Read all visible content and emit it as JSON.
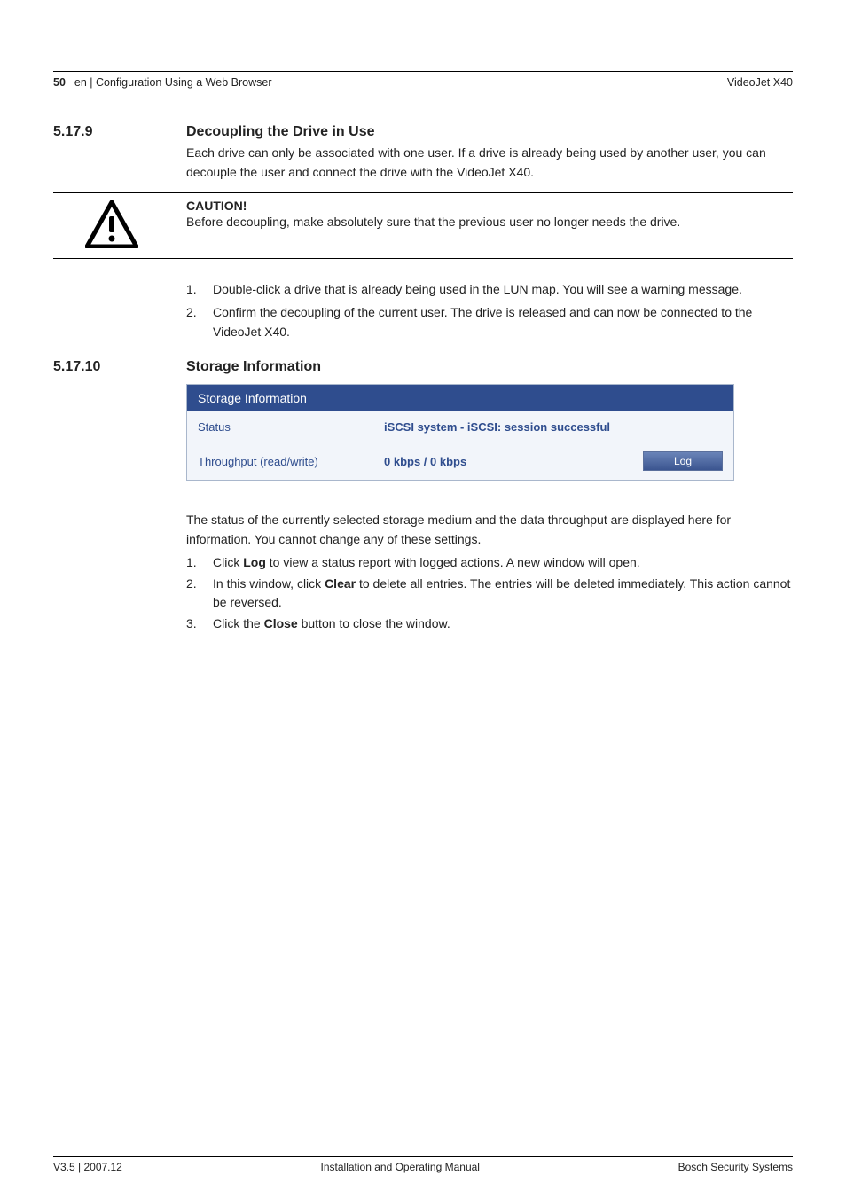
{
  "header": {
    "page_number": "50",
    "breadcrumb": "en | Configuration Using a Web Browser",
    "product": "VideoJet X40"
  },
  "section1": {
    "number": "5.17.9",
    "title": "Decoupling the Drive in Use",
    "intro": "Each drive can only be associated with one user. If a drive is already being used by another user, you can decouple the user and connect the drive with the VideoJet X40.",
    "caution_heading": "CAUTION!",
    "caution_text": "Before decoupling, make absolutely sure that the previous user no longer needs the drive.",
    "steps": {
      "n1": "1.",
      "t1": "Double-click a drive that is already being used in the LUN map. You will see a warning message.",
      "n2": "2.",
      "t2": "Confirm the decoupling of the current user. The drive is released and can now be connected to the VideoJet X40."
    }
  },
  "section2": {
    "number": "5.17.10",
    "title": "Storage Information",
    "screenshot": {
      "panel_title": "Storage Information",
      "status_label": "Status",
      "status_value": "iSCSI system - iSCSI: session successful",
      "throughput_label": "Throughput (read/write)",
      "throughput_value": "0 kbps / 0 kbps",
      "log_button": "Log"
    },
    "desc": "The status of the currently selected storage medium and the data throughput are displayed here for information. You cannot change any of these settings.",
    "steps": {
      "n1": "1.",
      "t1a": "Click ",
      "t1b": "Log",
      "t1c": " to view a status report with logged actions. A new window will open.",
      "n2": "2.",
      "t2a": "In this window, click ",
      "t2b": "Clear",
      "t2c": " to delete all entries. The entries will be deleted immediately. This action cannot be reversed.",
      "n3": "3.",
      "t3a": "Click the ",
      "t3b": "Close",
      "t3c": " button to close the window."
    }
  },
  "footer": {
    "left": "V3.5 | 2007.12",
    "center": "Installation and Operating Manual",
    "right": "Bosch Security Systems"
  },
  "icons": {
    "caution": "caution-triangle-icon"
  }
}
